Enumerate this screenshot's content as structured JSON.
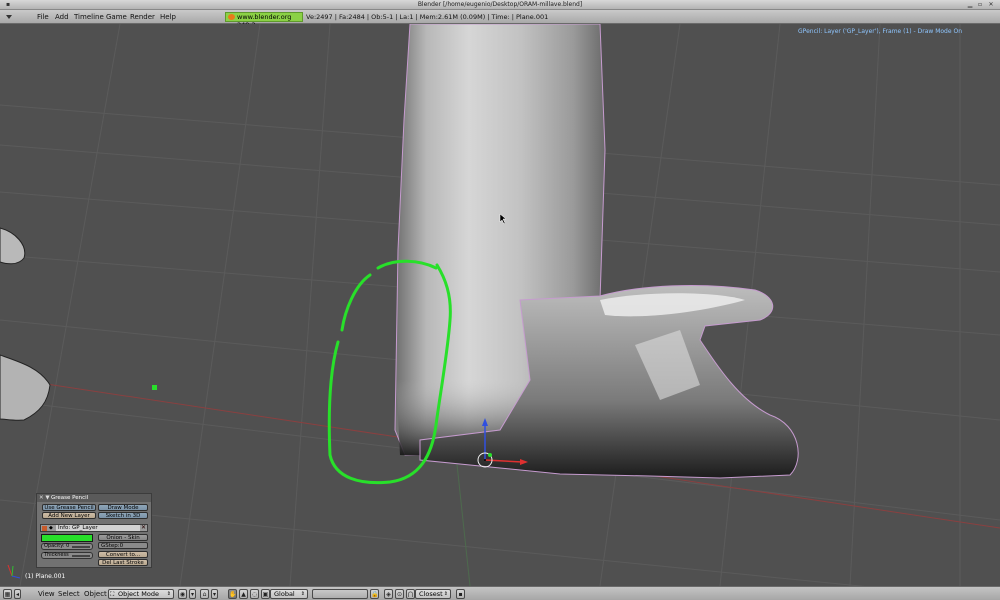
{
  "window": {
    "title": "Blender [/home/eugenio/Desktop/ORAM-millave.blend]"
  },
  "menu": [
    "File",
    "Add",
    "Timeline",
    "Game",
    "Render",
    "Help"
  ],
  "version_badge": "www.blender.org 249.2",
  "stats": "Ve:2497 | Fa:2484 | Ob:5-1 | La:1  | Mem:2.61M (0.09M)  | Time: | Plane.001",
  "viewport": {
    "gp_status": "GPencil: Layer ('GP_Layer'), Frame (1) - Draw Mode On",
    "object_label": "(1) Plane.001"
  },
  "grease_pencil": {
    "header": "Grease Pencil",
    "use_button": "Use Grease Pencil",
    "draw_mode": "Draw Mode",
    "add_layer": "Add New Layer",
    "sketch_3d": "Sketch in 3D",
    "layer_name": "Info: GP_Layer",
    "onion_skin": "Onion - Skin",
    "opacity": "Opacity: 0",
    "gstep": "GStep:0",
    "thickness": "Thickness",
    "convert": "Convert to...",
    "del_last": "Del Last Stroke",
    "stroke_color": "#28e02a"
  },
  "bottom": {
    "menus": [
      "View",
      "Select",
      "Object"
    ],
    "mode": "Object Mode",
    "orientation": "Global",
    "snap": "Closest"
  },
  "colors": {
    "accent_green": "#28e02a",
    "axis_red": "#e03030",
    "axis_blue": "#3050e0",
    "gpencil_info": "#8fc6ff"
  }
}
